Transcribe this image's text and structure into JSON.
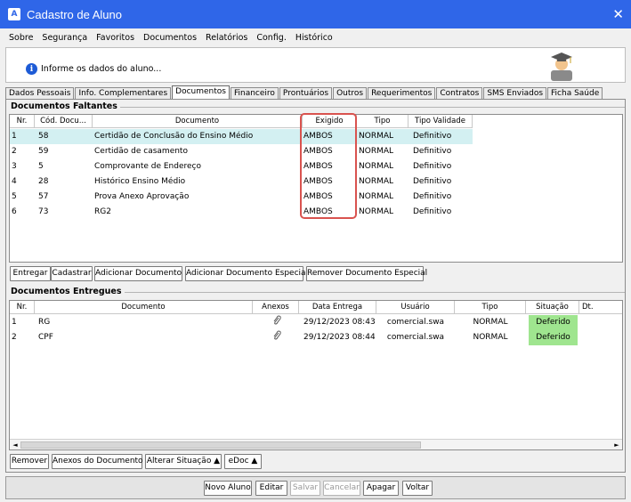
{
  "window": {
    "title": "Cadastro de Aluno",
    "close_glyph": "✕",
    "app_icon_letter": "A"
  },
  "menu": [
    "Sobre",
    "Segurança",
    "Favoritos",
    "Documentos",
    "Relatórios",
    "Config.",
    "Histórico"
  ],
  "info": {
    "text": "Informe os dados do aluno...",
    "icon": "info-icon"
  },
  "tabs": [
    {
      "label": "Dados Pessoais",
      "active": false
    },
    {
      "label": "Info. Complementares",
      "active": false
    },
    {
      "label": "Documentos",
      "active": true
    },
    {
      "label": "Financeiro",
      "active": false
    },
    {
      "label": "Prontuários",
      "active": false
    },
    {
      "label": "Outros",
      "active": false
    },
    {
      "label": "Requerimentos",
      "active": false
    },
    {
      "label": "Contratos",
      "active": false
    },
    {
      "label": "SMS Enviados",
      "active": false
    },
    {
      "label": "Ficha Saúde",
      "active": false
    }
  ],
  "faltantes": {
    "title": "Documentos Faltantes",
    "columns": [
      "Nr.",
      "Cód. Docu...",
      "Documento",
      "Exigido",
      "Tipo",
      "Tipo Validade"
    ],
    "rows": [
      {
        "nr": "1",
        "cod": "58",
        "doc": "Certidão de Conclusão do Ensino Médio",
        "exigido": "AMBOS",
        "tipo": "NORMAL",
        "validade": "Definitivo"
      },
      {
        "nr": "2",
        "cod": "59",
        "doc": "Certidão de casamento",
        "exigido": "AMBOS",
        "tipo": "NORMAL",
        "validade": "Definitivo"
      },
      {
        "nr": "3",
        "cod": "5",
        "doc": "Comprovante de Endereço",
        "exigido": "AMBOS",
        "tipo": "NORMAL",
        "validade": "Definitivo"
      },
      {
        "nr": "4",
        "cod": "28",
        "doc": "Histórico Ensino Médio",
        "exigido": "AMBOS",
        "tipo": "NORMAL",
        "validade": "Definitivo"
      },
      {
        "nr": "5",
        "cod": "57",
        "doc": "Prova Anexo Aprovação",
        "exigido": "AMBOS",
        "tipo": "NORMAL",
        "validade": "Definitivo"
      },
      {
        "nr": "6",
        "cod": "73",
        "doc": "RG2",
        "exigido": "AMBOS",
        "tipo": "NORMAL",
        "validade": "Definitivo"
      }
    ],
    "buttons": [
      "Entregar",
      "Cadastrar",
      "Adicionar Documento",
      "Adicionar Documento Especial",
      "Remover Documento Especial"
    ]
  },
  "entregues": {
    "title": "Documentos Entregues",
    "columns": [
      "Nr.",
      "Documento",
      "Anexos",
      "Data Entrega",
      "Usuário",
      "Tipo",
      "Situação",
      "Dt. Avaliaçã"
    ],
    "rows": [
      {
        "nr": "1",
        "doc": "RG",
        "anexo": "paperclip-icon",
        "data": "29/12/2023 08:43",
        "usuario": "comercial.swa",
        "tipo": "NORMAL",
        "situacao": "Deferido"
      },
      {
        "nr": "2",
        "doc": "CPF",
        "anexo": "paperclip-icon",
        "data": "29/12/2023 08:44",
        "usuario": "comercial.swa",
        "tipo": "NORMAL",
        "situacao": "Deferido"
      }
    ],
    "buttons": [
      "Remover",
      "Anexos do Documento",
      "Alterar Situação ▲",
      "eDoc ▲"
    ],
    "scroll_left": "◄",
    "scroll_right": "►"
  },
  "footer_buttons": [
    {
      "label": "Novo Aluno",
      "enabled": true
    },
    {
      "label": "Editar",
      "enabled": true
    },
    {
      "label": "Salvar",
      "enabled": false
    },
    {
      "label": "Cancelar",
      "enabled": false
    },
    {
      "label": "Apagar",
      "enabled": true
    },
    {
      "label": "Voltar",
      "enabled": true
    }
  ],
  "colors": {
    "titlebar": "#2f66e8",
    "selected_row": "#d3f0f2",
    "deferido": "#9fe58f",
    "highlight": "#d9534f"
  }
}
